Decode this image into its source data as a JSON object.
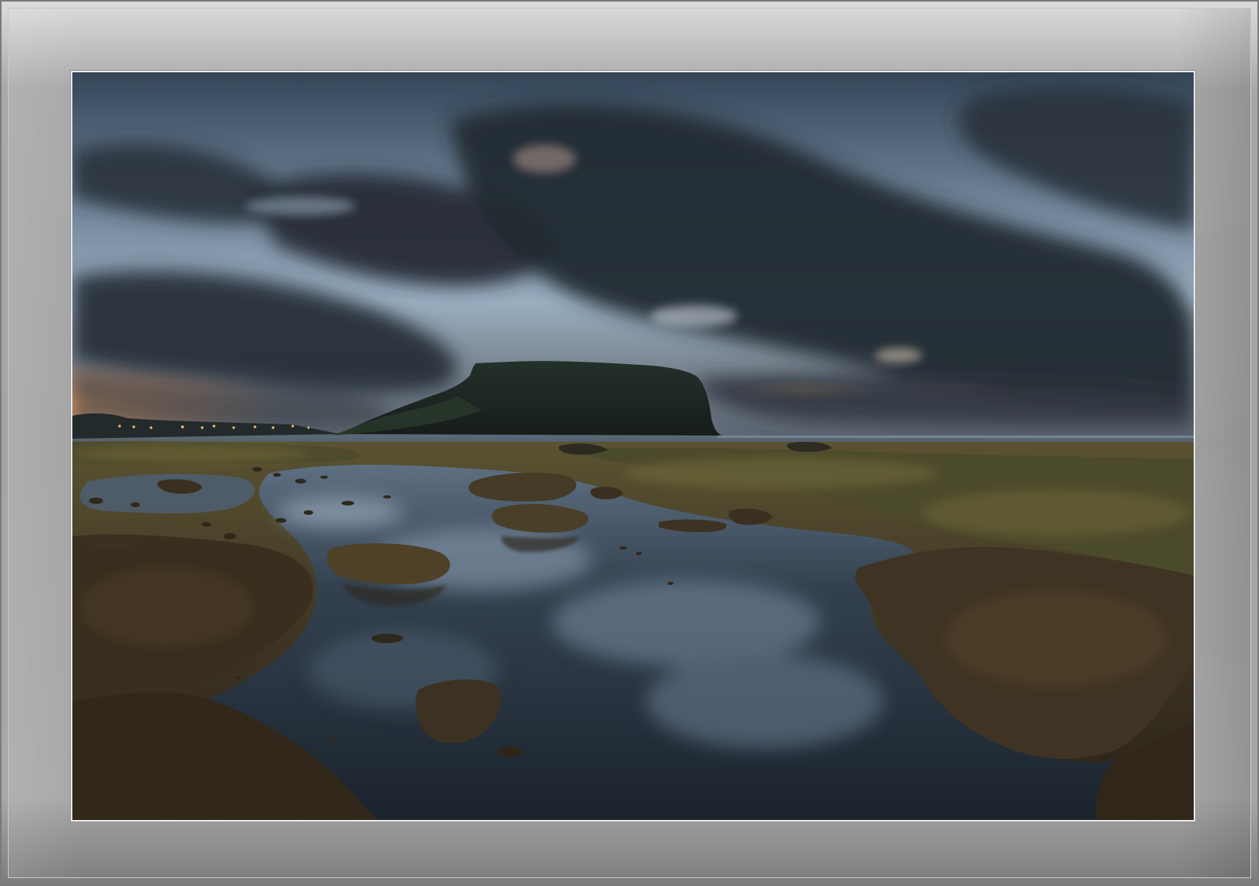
{
  "colors": {
    "frame": "#a6a6a6",
    "sky_top": "#3d4e63",
    "sky_mid": "#8fa4b8",
    "cloud": "#2a313b",
    "sunset": "#e8a15a",
    "mountain": "#1b2420",
    "sea": "#4a5867",
    "rock": "#3d3423",
    "moss": "#5a5330",
    "water": "#1f2a36",
    "water_reflection": "#8b9db1",
    "town_light": "#f4c470"
  }
}
